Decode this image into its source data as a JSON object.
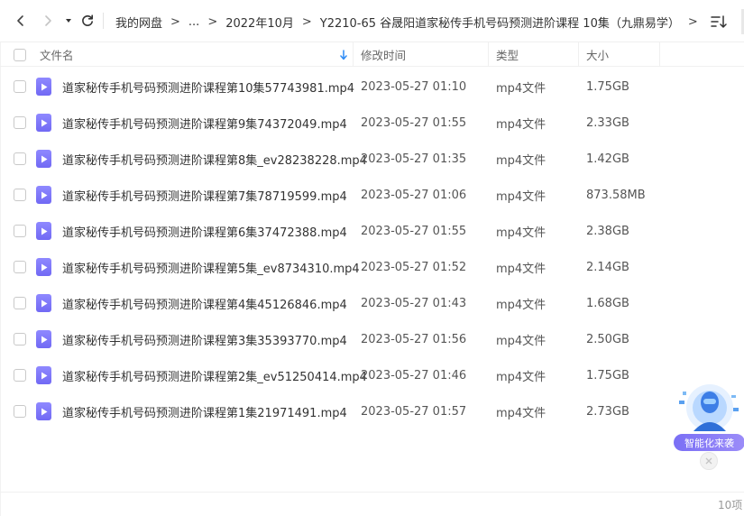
{
  "toolbar": {
    "back_icon": "chevron-left-icon",
    "forward_icon": "chevron-right-icon",
    "dropdown_icon": "caret-down-icon",
    "refresh_icon": "refresh-icon",
    "sort_icon": "sort-icon"
  },
  "breadcrumb": {
    "items": [
      "我的网盘",
      "...",
      "2022年10月",
      "Y2210-65 谷晟阳道家秘传手机号码预测进阶课程 10集（九鼎易学）"
    ],
    "separator": ">"
  },
  "header": {
    "name": "文件名",
    "time": "修改时间",
    "type": "类型",
    "size": "大小"
  },
  "files": [
    {
      "name": "道家秘传手机号码预测进阶课程第10集57743981.mp4",
      "time": "2023-05-27 01:10",
      "type": "mp4文件",
      "size": "1.75GB"
    },
    {
      "name": "道家秘传手机号码预测进阶课程第9集74372049.mp4",
      "time": "2023-05-27 01:55",
      "type": "mp4文件",
      "size": "2.33GB"
    },
    {
      "name": "道家秘传手机号码预测进阶课程第8集_ev28238228.mp4",
      "time": "2023-05-27 01:35",
      "type": "mp4文件",
      "size": "1.42GB"
    },
    {
      "name": "道家秘传手机号码预测进阶课程第7集78719599.mp4",
      "time": "2023-05-27 01:06",
      "type": "mp4文件",
      "size": "873.58MB"
    },
    {
      "name": "道家秘传手机号码预测进阶课程第6集37472388.mp4",
      "time": "2023-05-27 01:55",
      "type": "mp4文件",
      "size": "2.38GB"
    },
    {
      "name": "道家秘传手机号码预测进阶课程第5集_ev8734310.mp4",
      "time": "2023-05-27 01:52",
      "type": "mp4文件",
      "size": "2.14GB"
    },
    {
      "name": "道家秘传手机号码预测进阶课程第4集45126846.mp4",
      "time": "2023-05-27 01:43",
      "type": "mp4文件",
      "size": "1.68GB"
    },
    {
      "name": "道家秘传手机号码预测进阶课程第3集35393770.mp4",
      "time": "2023-05-27 01:56",
      "type": "mp4文件",
      "size": "2.50GB"
    },
    {
      "name": "道家秘传手机号码预测进阶课程第2集_ev51250414.mp4",
      "time": "2023-05-27 01:46",
      "type": "mp4文件",
      "size": "1.75GB"
    },
    {
      "name": "道家秘传手机号码预测进阶课程第1集21971491.mp4",
      "time": "2023-05-27 01:57",
      "type": "mp4文件",
      "size": "2.73GB"
    }
  ],
  "widget": {
    "label": "智能化来袭",
    "close_icon": "close-icon"
  },
  "footer": {
    "count": "10项"
  },
  "colors": {
    "accent": "#7a6ff5",
    "file_icon": "#7f78f7",
    "sort_arrow": "#2f8cf5"
  }
}
